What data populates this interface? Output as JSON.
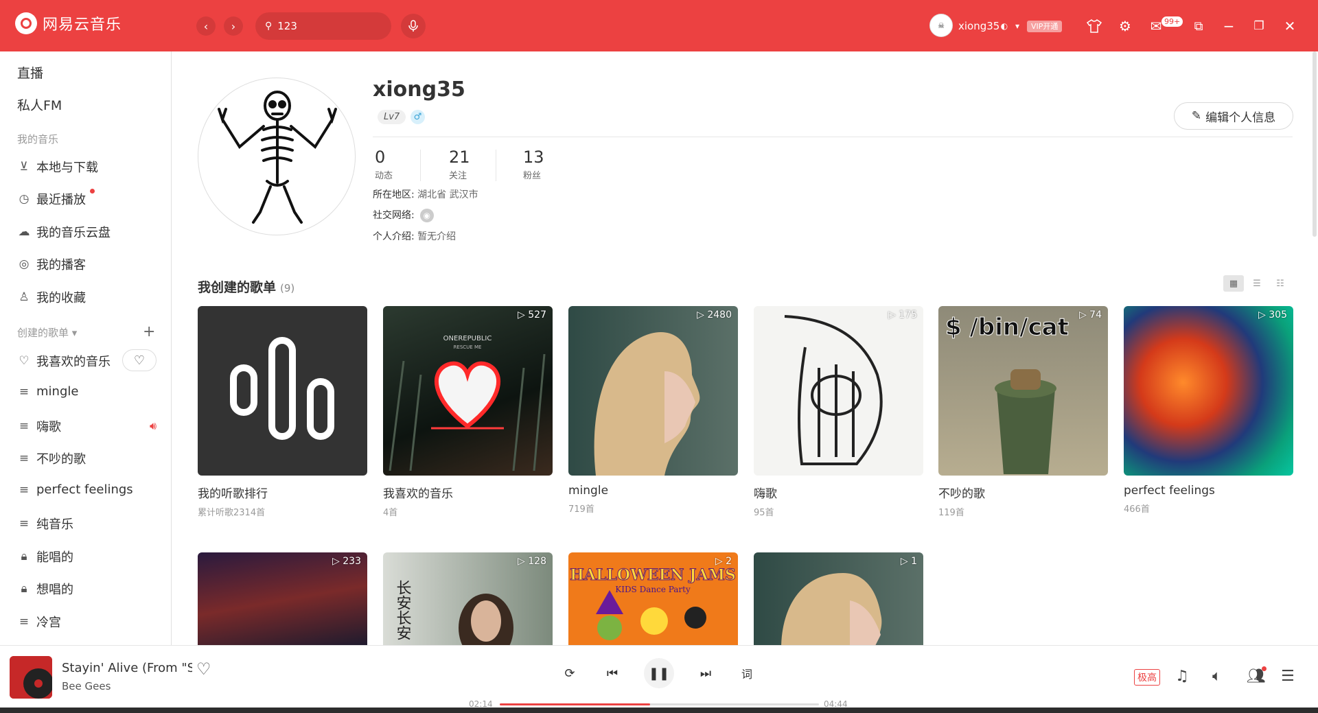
{
  "app": {
    "name": "网易云音乐"
  },
  "topbar": {
    "search_value": "123",
    "username": "xiong35",
    "vip_label": "VIP开通",
    "mail_badge": "99+"
  },
  "sidebar": {
    "live": "直播",
    "fm": "私人FM",
    "my_music_header": "我的音乐",
    "my_music": [
      {
        "label": "本地与下载"
      },
      {
        "label": "最近播放"
      },
      {
        "label": "我的音乐云盘"
      },
      {
        "label": "我的播客"
      },
      {
        "label": "我的收藏"
      }
    ],
    "created_header": "创建的歌单",
    "created": [
      {
        "label": "我喜欢的音乐"
      },
      {
        "label": "mingle"
      },
      {
        "label": "嗨歌"
      },
      {
        "label": "不吵的歌"
      },
      {
        "label": "perfect feelings"
      },
      {
        "label": "纯音乐"
      },
      {
        "label": "能唱的"
      },
      {
        "label": "想唱的"
      },
      {
        "label": "冷宫"
      }
    ]
  },
  "profile": {
    "username": "xiong35",
    "level": "Lv7",
    "gender_icon": "male-icon",
    "edit_label": "编辑个人信息",
    "stats": [
      {
        "num": "0",
        "label": "动态"
      },
      {
        "num": "21",
        "label": "关注"
      },
      {
        "num": "13",
        "label": "粉丝"
      }
    ],
    "region_label": "所在地区:",
    "region_value": "湖北省 武汉市",
    "social_label": "社交网络:",
    "intro_label": "个人介绍:",
    "intro_value": "暂无介绍"
  },
  "playlists_section": {
    "title": "我创建的歌单",
    "count": "(9)"
  },
  "playlists": [
    {
      "name": "我的听歌排行",
      "sub": "累计听歌2314首",
      "plays": ""
    },
    {
      "name": "我喜欢的音乐",
      "sub": "4首",
      "plays": "▷ 527"
    },
    {
      "name": "mingle",
      "sub": "719首",
      "plays": "▷ 2480"
    },
    {
      "name": "嗨歌",
      "sub": "95首",
      "plays": "▷ 175"
    },
    {
      "name": "不吵的歌",
      "sub": "119首",
      "plays": "▷ 74"
    },
    {
      "name": "perfect feelings",
      "sub": "466首",
      "plays": "▷ 305"
    }
  ],
  "playlists_row2": [
    {
      "plays": "▷ 233"
    },
    {
      "plays": "▷ 128"
    },
    {
      "plays": "▷ 2"
    },
    {
      "plays": "▷ 1"
    }
  ],
  "cover_texts": {
    "onerepublic": "ONEREPUBLIC",
    "rescue": "RESCUE ME",
    "bincat": "$ /bin/cat",
    "changan": "长安长安",
    "halloween": "HALLOWEEN JAMS",
    "kids": "KIDS Dance Party"
  },
  "player": {
    "title": "Stayin' Alive (From \"Saturday Night Fever\")",
    "artist": "Bee Gees",
    "current_time": "02:14",
    "total_time": "04:44",
    "progress": 0.47,
    "lyric_label": "词",
    "quality_label": "极高"
  }
}
